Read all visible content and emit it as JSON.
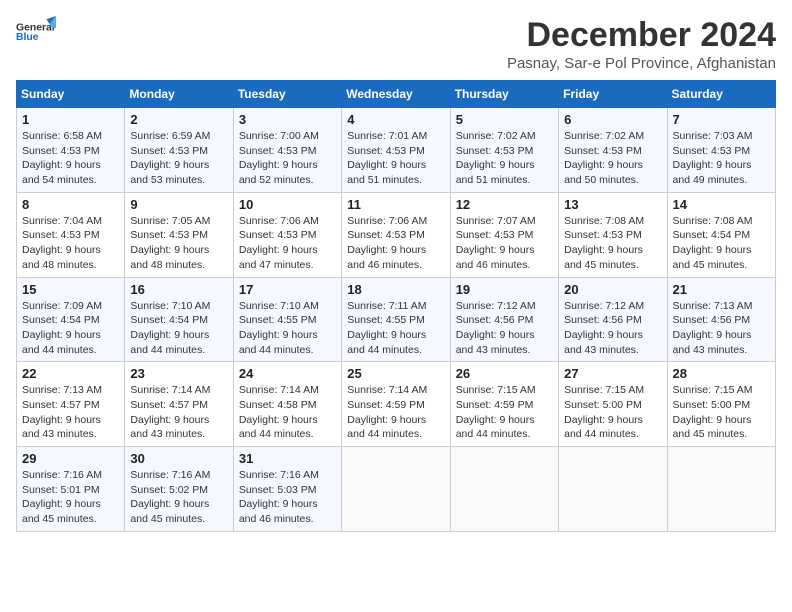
{
  "logo": {
    "general": "General",
    "blue": "Blue"
  },
  "title": {
    "month": "December 2024",
    "location": "Pasnay, Sar-e Pol Province, Afghanistan"
  },
  "weekdays": [
    "Sunday",
    "Monday",
    "Tuesday",
    "Wednesday",
    "Thursday",
    "Friday",
    "Saturday"
  ],
  "weeks": [
    [
      {
        "day": "1",
        "sunrise": "6:58 AM",
        "sunset": "4:53 PM",
        "daylight": "9 hours and 54 minutes."
      },
      {
        "day": "2",
        "sunrise": "6:59 AM",
        "sunset": "4:53 PM",
        "daylight": "9 hours and 53 minutes."
      },
      {
        "day": "3",
        "sunrise": "7:00 AM",
        "sunset": "4:53 PM",
        "daylight": "9 hours and 52 minutes."
      },
      {
        "day": "4",
        "sunrise": "7:01 AM",
        "sunset": "4:53 PM",
        "daylight": "9 hours and 51 minutes."
      },
      {
        "day": "5",
        "sunrise": "7:02 AM",
        "sunset": "4:53 PM",
        "daylight": "9 hours and 51 minutes."
      },
      {
        "day": "6",
        "sunrise": "7:02 AM",
        "sunset": "4:53 PM",
        "daylight": "9 hours and 50 minutes."
      },
      {
        "day": "7",
        "sunrise": "7:03 AM",
        "sunset": "4:53 PM",
        "daylight": "9 hours and 49 minutes."
      }
    ],
    [
      {
        "day": "8",
        "sunrise": "7:04 AM",
        "sunset": "4:53 PM",
        "daylight": "9 hours and 48 minutes."
      },
      {
        "day": "9",
        "sunrise": "7:05 AM",
        "sunset": "4:53 PM",
        "daylight": "9 hours and 48 minutes."
      },
      {
        "day": "10",
        "sunrise": "7:06 AM",
        "sunset": "4:53 PM",
        "daylight": "9 hours and 47 minutes."
      },
      {
        "day": "11",
        "sunrise": "7:06 AM",
        "sunset": "4:53 PM",
        "daylight": "9 hours and 46 minutes."
      },
      {
        "day": "12",
        "sunrise": "7:07 AM",
        "sunset": "4:53 PM",
        "daylight": "9 hours and 46 minutes."
      },
      {
        "day": "13",
        "sunrise": "7:08 AM",
        "sunset": "4:53 PM",
        "daylight": "9 hours and 45 minutes."
      },
      {
        "day": "14",
        "sunrise": "7:08 AM",
        "sunset": "4:54 PM",
        "daylight": "9 hours and 45 minutes."
      }
    ],
    [
      {
        "day": "15",
        "sunrise": "7:09 AM",
        "sunset": "4:54 PM",
        "daylight": "9 hours and 44 minutes."
      },
      {
        "day": "16",
        "sunrise": "7:10 AM",
        "sunset": "4:54 PM",
        "daylight": "9 hours and 44 minutes."
      },
      {
        "day": "17",
        "sunrise": "7:10 AM",
        "sunset": "4:55 PM",
        "daylight": "9 hours and 44 minutes."
      },
      {
        "day": "18",
        "sunrise": "7:11 AM",
        "sunset": "4:55 PM",
        "daylight": "9 hours and 44 minutes."
      },
      {
        "day": "19",
        "sunrise": "7:12 AM",
        "sunset": "4:56 PM",
        "daylight": "9 hours and 43 minutes."
      },
      {
        "day": "20",
        "sunrise": "7:12 AM",
        "sunset": "4:56 PM",
        "daylight": "9 hours and 43 minutes."
      },
      {
        "day": "21",
        "sunrise": "7:13 AM",
        "sunset": "4:56 PM",
        "daylight": "9 hours and 43 minutes."
      }
    ],
    [
      {
        "day": "22",
        "sunrise": "7:13 AM",
        "sunset": "4:57 PM",
        "daylight": "9 hours and 43 minutes."
      },
      {
        "day": "23",
        "sunrise": "7:14 AM",
        "sunset": "4:57 PM",
        "daylight": "9 hours and 43 minutes."
      },
      {
        "day": "24",
        "sunrise": "7:14 AM",
        "sunset": "4:58 PM",
        "daylight": "9 hours and 44 minutes."
      },
      {
        "day": "25",
        "sunrise": "7:14 AM",
        "sunset": "4:59 PM",
        "daylight": "9 hours and 44 minutes."
      },
      {
        "day": "26",
        "sunrise": "7:15 AM",
        "sunset": "4:59 PM",
        "daylight": "9 hours and 44 minutes."
      },
      {
        "day": "27",
        "sunrise": "7:15 AM",
        "sunset": "5:00 PM",
        "daylight": "9 hours and 44 minutes."
      },
      {
        "day": "28",
        "sunrise": "7:15 AM",
        "sunset": "5:00 PM",
        "daylight": "9 hours and 45 minutes."
      }
    ],
    [
      {
        "day": "29",
        "sunrise": "7:16 AM",
        "sunset": "5:01 PM",
        "daylight": "9 hours and 45 minutes."
      },
      {
        "day": "30",
        "sunrise": "7:16 AM",
        "sunset": "5:02 PM",
        "daylight": "9 hours and 45 minutes."
      },
      {
        "day": "31",
        "sunrise": "7:16 AM",
        "sunset": "5:03 PM",
        "daylight": "9 hours and 46 minutes."
      },
      null,
      null,
      null,
      null
    ]
  ],
  "labels": {
    "sunrise": "Sunrise:",
    "sunset": "Sunset:",
    "daylight": "Daylight:"
  }
}
